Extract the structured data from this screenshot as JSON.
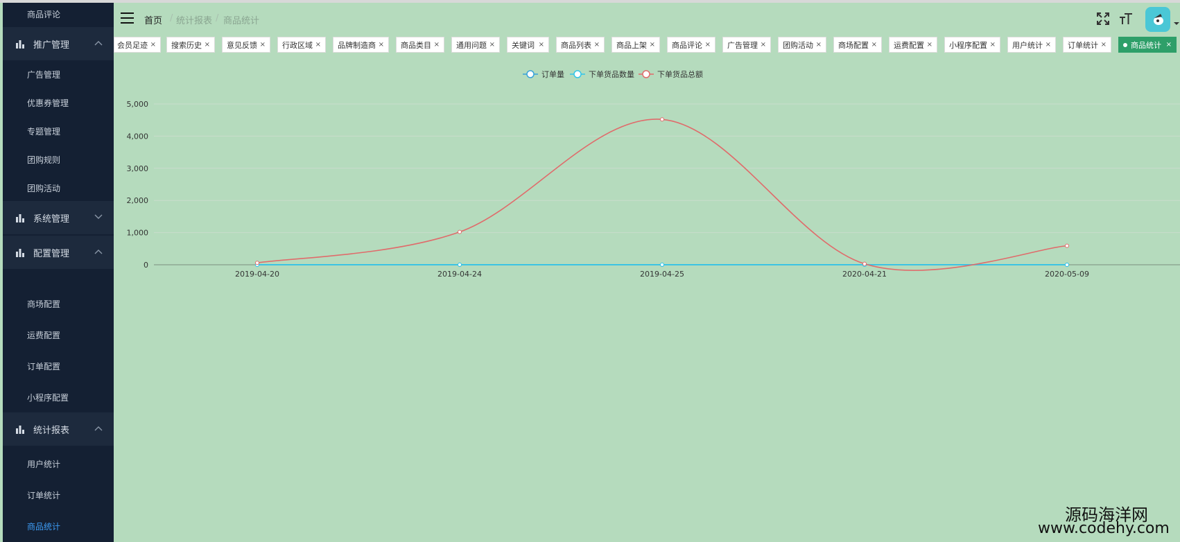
{
  "sidebar": {
    "top_item": "商品评论",
    "groups": [
      {
        "label": "推广管理",
        "items": [
          "广告管理",
          "优惠券管理",
          "专题管理",
          "团购规则",
          "团购活动"
        ]
      },
      {
        "label": "系统管理",
        "items": []
      },
      {
        "label": "配置管理",
        "items": [
          "商场配置",
          "运费配置",
          "订单配置",
          "小程序配置"
        ]
      },
      {
        "label": "统计报表",
        "items": [
          "用户统计",
          "订单统计",
          "商品统计"
        ]
      }
    ],
    "active_item": "商品统计",
    "active_color": "#3d9cf5"
  },
  "header": {
    "breadcrumb": [
      "首页",
      "统计报表",
      "商品统计"
    ],
    "separator": "/",
    "icons": [
      "fullscreen-icon",
      "font-size-icon",
      "avatar"
    ]
  },
  "tabs": [
    {
      "label": "会员足迹"
    },
    {
      "label": "搜索历史"
    },
    {
      "label": "意见反馈"
    },
    {
      "label": "行政区域"
    },
    {
      "label": "品牌制造商"
    },
    {
      "label": "商品类目"
    },
    {
      "label": "通用问题"
    },
    {
      "label": "关键词"
    },
    {
      "label": "商品列表"
    },
    {
      "label": "商品上架"
    },
    {
      "label": "商品评论"
    },
    {
      "label": "广告管理"
    },
    {
      "label": "团购活动"
    },
    {
      "label": "商场配置"
    },
    {
      "label": "运费配置"
    },
    {
      "label": "小程序配置"
    },
    {
      "label": "用户统计"
    },
    {
      "label": "订单统计"
    },
    {
      "label": "商品统计",
      "active": true
    }
  ],
  "tab_close": "×",
  "chart_data": {
    "type": "line",
    "smooth": true,
    "categories": [
      "2019-04-20",
      "2019-04-24",
      "2019-04-25",
      "2020-04-21",
      "2020-05-09"
    ],
    "series": [
      {
        "name": "订单量",
        "values": [
          1,
          1,
          1,
          1,
          1
        ],
        "color": "#37a2da"
      },
      {
        "name": "下单货品数量",
        "values": [
          1,
          2,
          2,
          1,
          1
        ],
        "color": "#32c5e9"
      },
      {
        "name": "下单货品总额",
        "values": [
          60,
          1020,
          4520,
          30,
          590
        ],
        "color": "#e06b6b"
      }
    ],
    "ylim": [
      0,
      5000
    ],
    "yticks": [
      0,
      1000,
      2000,
      3000,
      4000,
      5000
    ],
    "ytick_labels": [
      "0",
      "1,000",
      "2,000",
      "3,000",
      "4,000",
      "5,000"
    ],
    "grid": true,
    "legend": "top-center"
  },
  "watermark": {
    "line1": "源码海洋网",
    "line2": "www.codehy.com"
  }
}
